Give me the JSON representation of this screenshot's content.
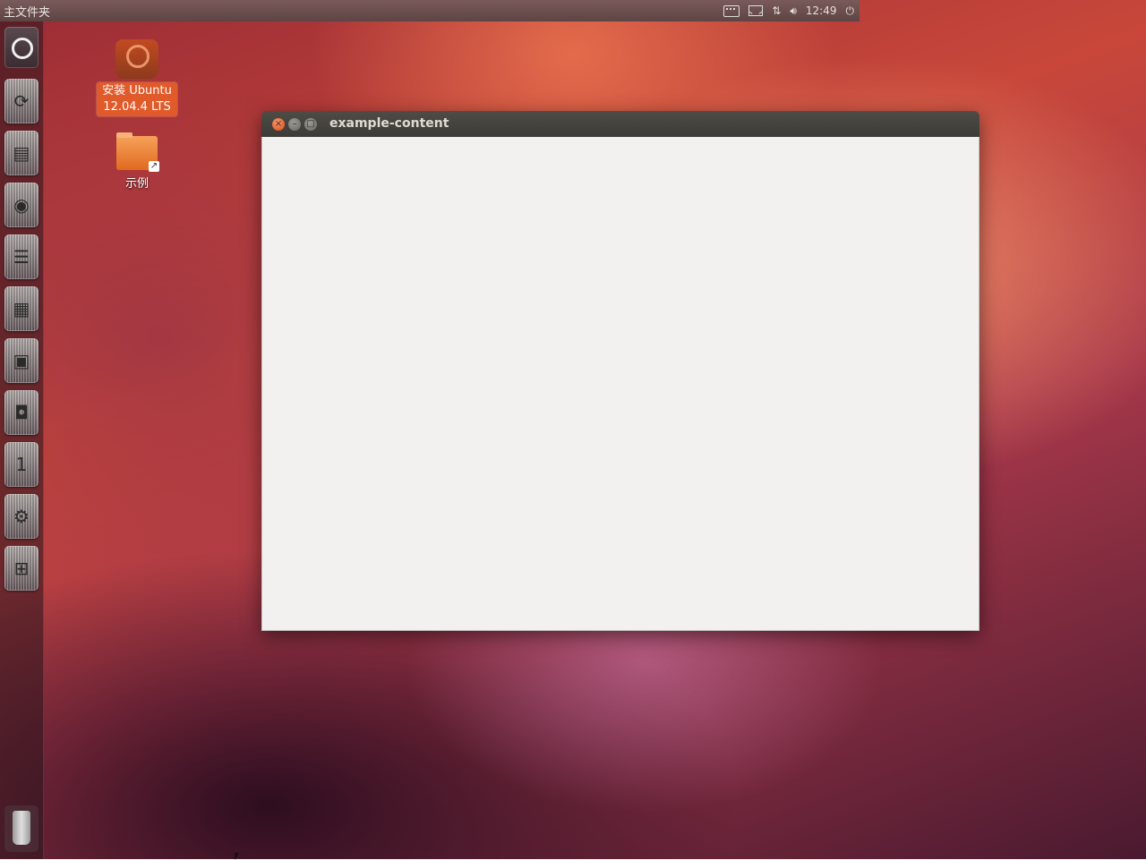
{
  "top_panel": {
    "title": "主文件夹",
    "clock": "12:49"
  },
  "launcher": {
    "items": [
      {
        "name": "dash-home"
      },
      {
        "name": "software-updater"
      },
      {
        "name": "files"
      },
      {
        "name": "firefox"
      },
      {
        "name": "writer"
      },
      {
        "name": "calc"
      },
      {
        "name": "impress"
      },
      {
        "name": "software-center"
      },
      {
        "name": "ubuntu-one"
      },
      {
        "name": "system-settings"
      },
      {
        "name": "workspace-switcher"
      },
      {
        "name": "trash"
      }
    ]
  },
  "desktop_icons": {
    "installer_label_line1": "安装 Ubuntu",
    "installer_label_line2": "12.04.4 LTS",
    "example_label": "示例"
  },
  "window": {
    "title": "example-content",
    "close_symbol": "×",
    "minimize_symbol": "–",
    "maximize_symbol": "□"
  }
}
